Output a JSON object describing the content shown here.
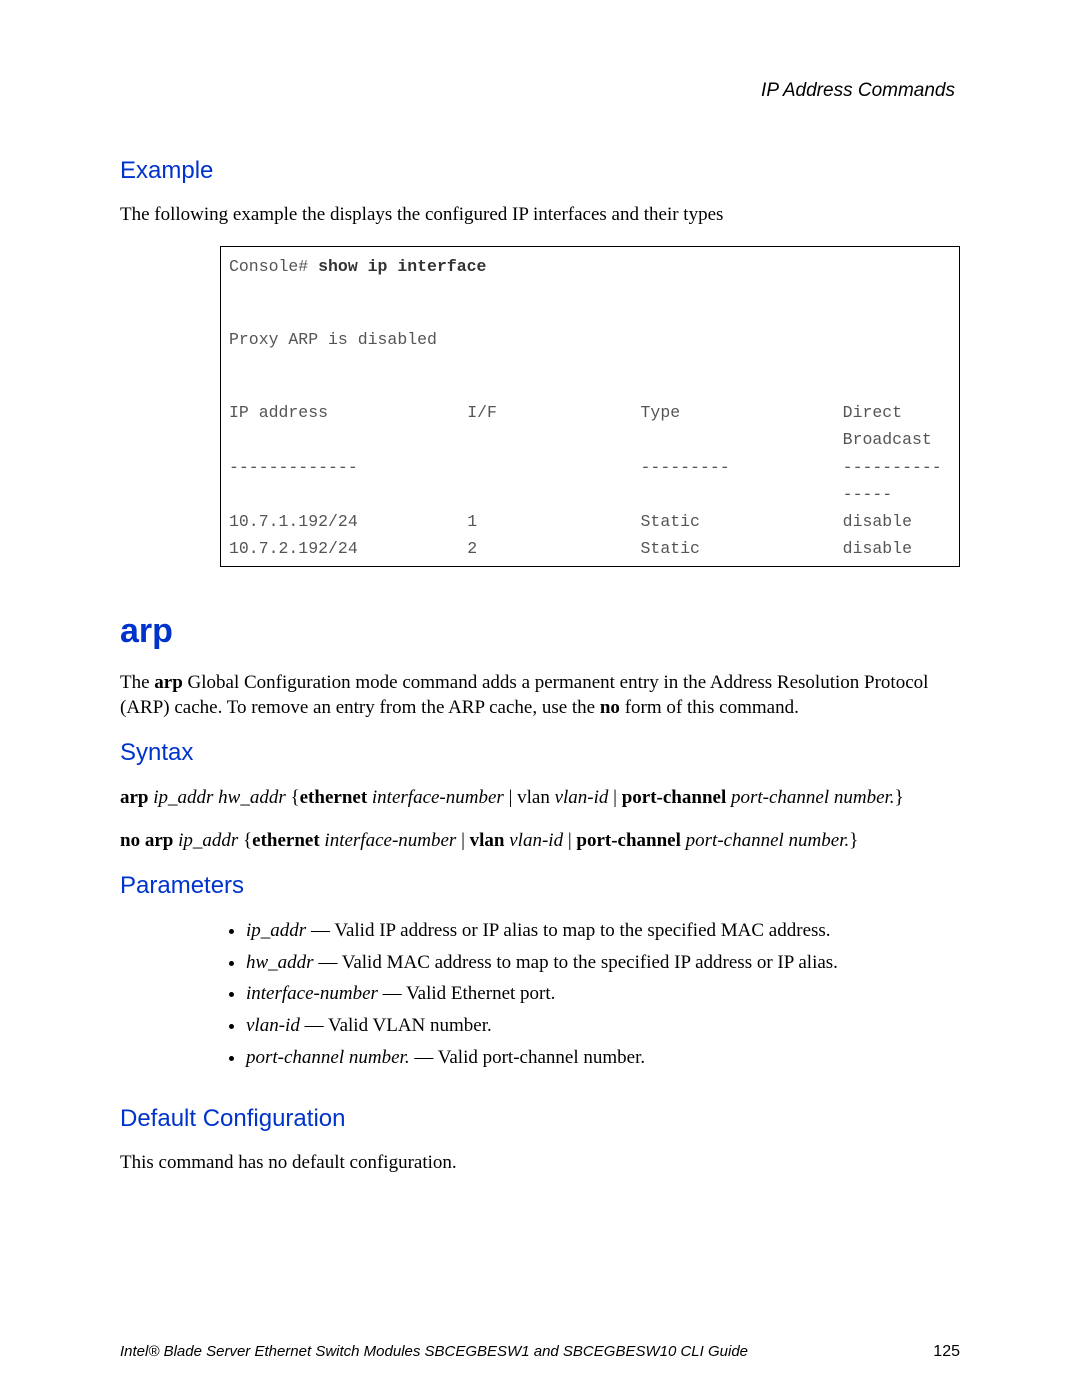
{
  "header": {
    "section": "IP Address Commands"
  },
  "example": {
    "heading": "Example",
    "intro": "The following example the displays the configured IP interfaces and their types",
    "prompt": "Console# ",
    "command": "show ip interface",
    "proxy_line": "Proxy ARP is disabled",
    "cols": {
      "c1": "IP address",
      "c2": "I/F",
      "c3": "Type",
      "c4": "Direct Broadcast"
    },
    "sep": {
      "c1": "-------------",
      "c3": "---------",
      "c4": "---------------"
    },
    "rows": [
      {
        "c1": "10.7.1.192/24",
        "c2": "1",
        "c3": "Static",
        "c4": "disable"
      },
      {
        "c1": "10.7.2.192/24",
        "c2": "2",
        "c3": "Static",
        "c4": "disable"
      }
    ]
  },
  "arp": {
    "title": "arp",
    "desc_pre": "The ",
    "desc_cmd": "arp",
    "desc_mid": " Global Configuration mode command adds a permanent entry in the Address Resolution Protocol (ARP) cache. To remove an entry from the ARP cache, use the ",
    "desc_no": "no",
    "desc_post": " form of this command."
  },
  "syntax": {
    "heading": "Syntax",
    "line1": {
      "b1": "arp",
      "i1": " ip_addr hw_addr ",
      "brace_open": "{",
      "b2": "ethernet",
      "i2": " interface-number ",
      "pipe1": "| vlan ",
      "i3": "vlan-id ",
      "pipe2": "| ",
      "b3": "port-channel",
      "i4": " port-channel number.",
      "brace_close": "}"
    },
    "line2": {
      "b1": "no arp",
      "i1": " ip_addr ",
      "brace_open": "{",
      "b2": "ethernet",
      "i2": " interface-number ",
      "pipe1": "| ",
      "b3": "vlan",
      "i3": " vlan-id ",
      "pipe2": "| ",
      "b4": "port-channel",
      "i4": " port-channel number.",
      "brace_close": "}"
    }
  },
  "parameters": {
    "heading": "Parameters",
    "items": [
      {
        "term": "ip_addr",
        "desc": " — Valid IP address or IP alias to map to the specified MAC address."
      },
      {
        "term": "hw_addr",
        "desc": " — Valid MAC address to map to the specified IP address or IP alias."
      },
      {
        "term": "interface-number",
        "desc": " — Valid Ethernet port."
      },
      {
        "term": "vlan-id",
        "desc": " — Valid VLAN number."
      },
      {
        "term": "port-channel number.",
        "desc": " — Valid port-channel number."
      }
    ]
  },
  "default": {
    "heading": "Default Configuration",
    "text": "This command has no default configuration."
  },
  "footer": {
    "title": "Intel® Blade Server Ethernet Switch Modules SBCEGBESW1 and SBCEGBESW10 CLI Guide",
    "page": "125"
  }
}
